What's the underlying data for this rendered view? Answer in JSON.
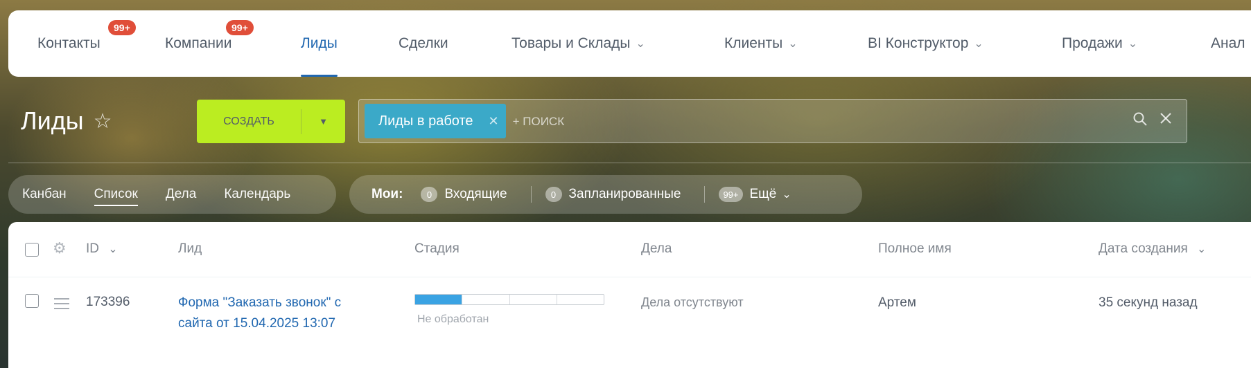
{
  "nav": {
    "items": [
      {
        "label": "Контакты",
        "badge": "99+"
      },
      {
        "label": "Компании",
        "badge": "99+"
      },
      {
        "label": "Лиды",
        "active": true
      },
      {
        "label": "Сделки"
      },
      {
        "label": "Товары и Склады",
        "dropdown": true
      },
      {
        "label": "Клиенты",
        "dropdown": true
      },
      {
        "label": "BI Конструктор",
        "dropdown": true
      },
      {
        "label": "Продажи",
        "dropdown": true
      },
      {
        "label": "Анал"
      }
    ]
  },
  "header": {
    "title": "Лиды",
    "create_label": "СОЗДАТЬ"
  },
  "search": {
    "filter_chip": "Лиды в работе",
    "placeholder": "+ поиск"
  },
  "views": {
    "items": [
      "Канбан",
      "Список",
      "Дела",
      "Календарь"
    ],
    "active": "Список"
  },
  "counters": {
    "label": "Мои:",
    "incoming_count": "0",
    "incoming_label": "Входящие",
    "planned_count": "0",
    "planned_label": "Запланированные",
    "more_count": "99+",
    "more_label": "Ещё"
  },
  "table": {
    "columns": {
      "id": "ID",
      "lead": "Лид",
      "stage": "Стадия",
      "activities": "Дела",
      "full_name": "Полное имя",
      "created": "Дата создания"
    },
    "rows": [
      {
        "id": "173396",
        "lead": "Форма \"Заказать звонок\" с сайта от 15.04.2025 13:07",
        "stage": "Не обработан",
        "stage_progress": 0.25,
        "activities": "Дела отсутствуют",
        "full_name": "Артем",
        "created": "35 секунд назад"
      }
    ]
  },
  "colors": {
    "accent": "#2067b0",
    "create_button": "#bbed21",
    "filter_chip": "#3ba9c8",
    "badge": "#e04e39",
    "stage_fill": "#3aa3e3"
  }
}
